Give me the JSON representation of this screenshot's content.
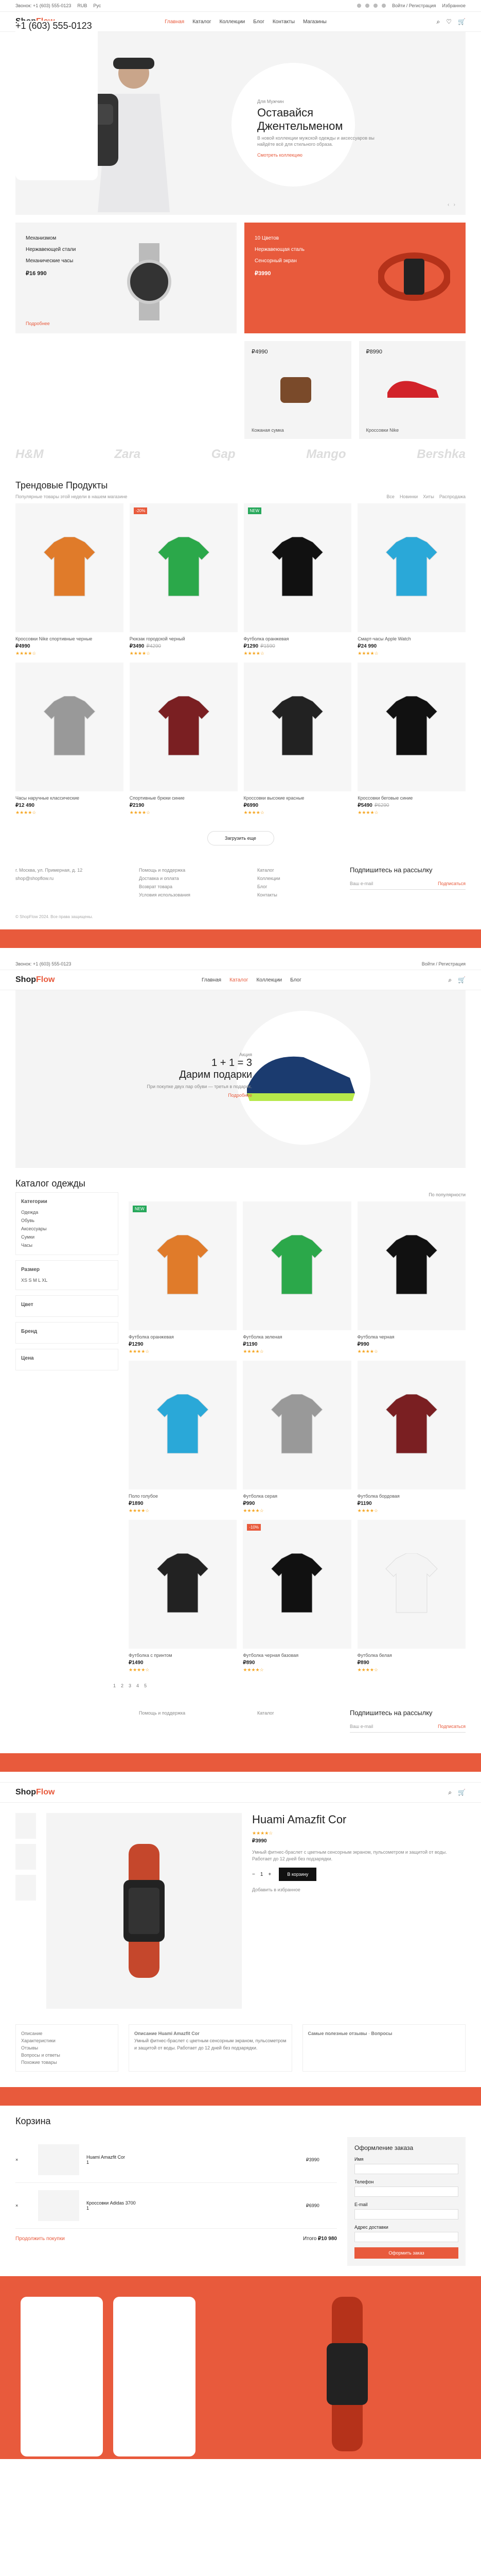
{
  "topbar": {
    "phone_info": "Звонок: +1 (603) 555-0123",
    "currency": "RUB",
    "lang": "Рус",
    "account": "Войти / Регистрация",
    "wishlist": "Избранное"
  },
  "nav": {
    "logo_main": "Shop",
    "logo_accent": "Flow",
    "items": [
      "Главная",
      "Каталог",
      "Коллекции",
      "Блог",
      "Контакты",
      "Магазины"
    ]
  },
  "hero": {
    "eyebrow": "Для Мужчин",
    "title": "Оставайся Джентельменом",
    "text": "В новой коллекции мужской одежды и аксессуаров вы найдёте всё для стильного образа.",
    "link": "Смотреть коллекцию"
  },
  "promo": {
    "left_list": [
      "Механизмом",
      "Нержавеющей стали",
      "Механические часы"
    ],
    "left_price": "₽16 990",
    "right_list": [
      "10 Цветов",
      "Нержавеющая сталь",
      "Сенсорный экран"
    ],
    "right_price": "₽3990",
    "more": "Подробнее",
    "mini1_price": "₽4990",
    "mini1_name": "Кожаная сумка",
    "mini2_price": "₽8990",
    "mini2_name": "Кроссовки Nike"
  },
  "brands": [
    "H&M",
    "Zara",
    "Gap",
    "Mango",
    "Bershka"
  ],
  "products_section": {
    "title": "Трендовые Продукты",
    "subtitle": "Популярные товары этой недели в нашем магазине",
    "tabs": [
      "Все",
      "Новинки",
      "Хиты",
      "Распродажа"
    ],
    "items": [
      {
        "name": "Кроссовки Nike спортивные черные",
        "price": "₽4990",
        "old": "",
        "badge": ""
      },
      {
        "name": "Рюкзак городской черный",
        "price": "₽3490",
        "old": "₽4290",
        "badge": "-20%"
      },
      {
        "name": "Футболка оранжевая",
        "price": "₽1290",
        "old": "₽1590",
        "badge": "NEW"
      },
      {
        "name": "Смарт-часы Apple Watch",
        "price": "₽24 990",
        "old": "",
        "badge": ""
      },
      {
        "name": "Часы наручные классические",
        "price": "₽12 490",
        "old": "",
        "badge": ""
      },
      {
        "name": "Спортивные брюки синие",
        "price": "₽2190",
        "old": "",
        "badge": ""
      },
      {
        "name": "Кроссовки высокие красные",
        "price": "₽6990",
        "old": "",
        "badge": ""
      },
      {
        "name": "Кроссовки беговые синие",
        "price": "₽5490",
        "old": "₽6290",
        "badge": ""
      }
    ],
    "load_more": "Загрузить еще"
  },
  "footer": {
    "phone": "+1 (603) 555-0123",
    "address": "г. Москва, ул. Примерная, д. 12",
    "email": "shop@shopflow.ru",
    "col2": [
      "Помощь и поддержка",
      "Доставка и оплата",
      "Возврат товара",
      "Условия использования"
    ],
    "col3": [
      "Каталог",
      "Коллекции",
      "Блог",
      "Контакты"
    ],
    "subscribe_title": "Подпишитесь на рассылку",
    "subscribe_placeholder": "Ваш e-mail",
    "subscribe_btn": "Подписаться",
    "copyright": "© ShopFlow 2024. Все права защищены."
  },
  "hero2": {
    "eyebrow": "Акция",
    "title1": "1 + 1 = 3",
    "title2": "Дарим подарки",
    "text": "При покупке двух пар обуви — третья в подарок.",
    "link": "Подробнее"
  },
  "catalog": {
    "title": "Каталог одежды",
    "sort": "По популярности",
    "filters": {
      "cat_title": "Категории",
      "cats": [
        "Одежда",
        "Обувь",
        "Аксессуары",
        "Сумки",
        "Часы"
      ],
      "size_title": "Размер",
      "sizes": [
        "XS",
        "S",
        "M",
        "L",
        "XL"
      ],
      "color_title": "Цвет",
      "brand_title": "Бренд",
      "price_title": "Цена"
    },
    "items": [
      {
        "name": "Футболка оранжевая",
        "price": "₽1290",
        "badge": "NEW"
      },
      {
        "name": "Футболка зеленая",
        "price": "₽1190",
        "badge": ""
      },
      {
        "name": "Футболка черная",
        "price": "₽990",
        "badge": ""
      },
      {
        "name": "Поло голубое",
        "price": "₽1890",
        "badge": ""
      },
      {
        "name": "Футболка серая",
        "price": "₽990",
        "badge": ""
      },
      {
        "name": "Футболка бордовая",
        "price": "₽1190",
        "badge": ""
      },
      {
        "name": "Футболка с принтом",
        "price": "₽1490",
        "badge": ""
      },
      {
        "name": "Футболка черная базовая",
        "price": "₽890",
        "badge": "-10%"
      },
      {
        "name": "Футболка белая",
        "price": "₽890",
        "badge": ""
      }
    ],
    "pages": [
      "1",
      "2",
      "3",
      "4",
      "5"
    ]
  },
  "product": {
    "title": "Huami Amazfit Cor",
    "price": "₽3990",
    "desc": "Умный фитнес-браслет с цветным сенсорным экраном, пульсометром и защитой от воды. Работает до 12 дней без подзарядки.",
    "add": "В корзину",
    "qty": "1",
    "wishlist": "Добавить в избранное",
    "tab_desc": "Описание Huami Amazfit Cor",
    "tab_reviews": "Самые полезные отзывы",
    "tab_questions": "Вопросы",
    "side_items": [
      "Описание",
      "Характеристики",
      "Отзывы",
      "Вопросы и ответы",
      "Похожие товары"
    ]
  },
  "cart": {
    "title": "Корзина",
    "rows": [
      {
        "name": "Huami Amazfit Cor",
        "qty": "1",
        "price": "₽3990"
      },
      {
        "name": "Кроссовки Adidas 3700",
        "qty": "1",
        "price": "₽6990"
      }
    ],
    "total_label": "Итого",
    "total": "₽10 980",
    "continue": "Продолжить покупки",
    "order_title": "Оформление заказа",
    "fields": [
      "Имя",
      "Телефон",
      "E-mail",
      "Адрес доставки"
    ],
    "submit": "Оформить заказ"
  },
  "colors": {
    "accent": "#e85a3c",
    "green": "#27a85b"
  }
}
